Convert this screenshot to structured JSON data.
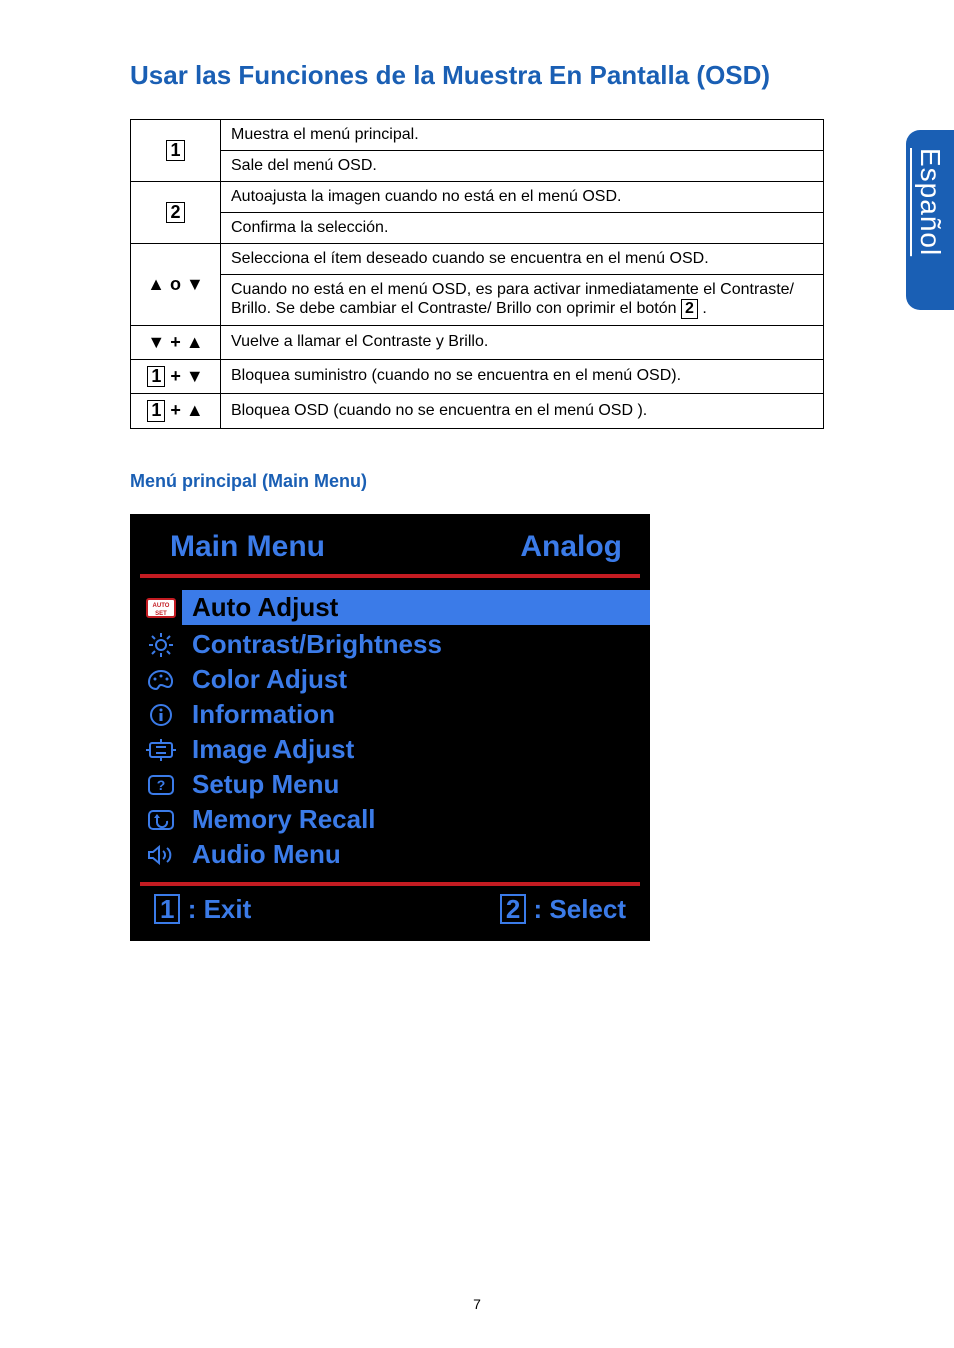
{
  "title": "Usar las Funciones de la Muestra En Pantalla (OSD)",
  "side_tab": "Español",
  "table": {
    "r1a": "Muestra el menú principal.",
    "r1b": "Sale del menú OSD.",
    "r2a": "Autoajusta la imagen cuando no está en el menú OSD.",
    "r2b": "Confirma la selección.",
    "r3a": "Selecciona el ítem deseado cuando se encuentra en el menú OSD.",
    "r3b_pre": "Cuando no está en el menú OSD, es para activar inmediatamente el Contraste/ Brillo. Se debe cambiar el Contraste/ Brillo con oprimir el botón ",
    "r3b_post": " .",
    "r4": "Vuelve a llamar el Contraste y Brillo.",
    "r5": "Bloquea suministro (cuando no se encuentra en el menú OSD).",
    "r6": "Bloquea OSD (cuando no se encuentra en el menú OSD )."
  },
  "keys": {
    "k1": "1",
    "k2": "2",
    "updown": "▲ o ▼",
    "both": "▼ + ▲",
    "onedown": "+ ▼",
    "oneup": "+ ▲"
  },
  "subheading": "Menú principal (Main Menu)",
  "osd": {
    "title_left": "Main Menu",
    "title_right": "Analog",
    "items": [
      {
        "label": "Auto Adjust",
        "selected": true
      },
      {
        "label": "Contrast/Brightness"
      },
      {
        "label": "Color Adjust"
      },
      {
        "label": "Information"
      },
      {
        "label": "Image Adjust"
      },
      {
        "label": "Setup Menu"
      },
      {
        "label": "Memory Recall"
      },
      {
        "label": "Audio Menu"
      }
    ],
    "footer_left": " : Exit",
    "footer_right": " : Select",
    "footer_key1": "1",
    "footer_key2": "2"
  },
  "page_number": "7"
}
